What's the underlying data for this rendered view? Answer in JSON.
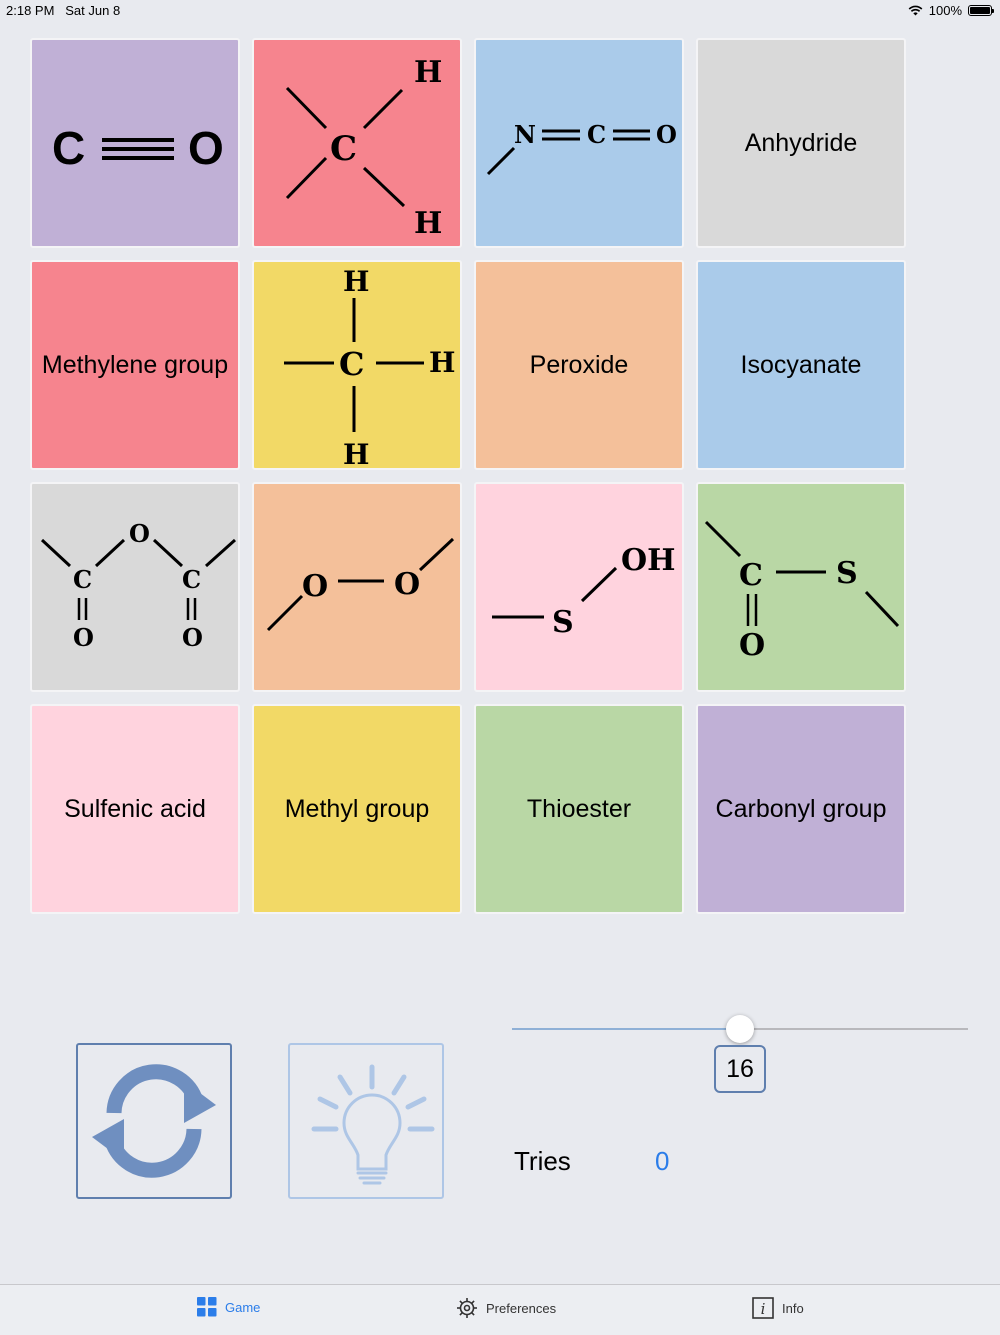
{
  "status_bar": {
    "time": "2:18 PM",
    "date": "Sat Jun 8",
    "battery": "100%"
  },
  "grid": {
    "cards": [
      {
        "kind": "structure",
        "molecule": "carbonyl",
        "color": "#c0b0d6"
      },
      {
        "kind": "structure",
        "molecule": "methylene",
        "color": "#f6848e"
      },
      {
        "kind": "structure",
        "molecule": "isocyanate",
        "color": "#aacbea"
      },
      {
        "kind": "label",
        "text": "Anhydride",
        "color": "#d9d9d9"
      },
      {
        "kind": "label",
        "text": "Methylene group",
        "color": "#f6848e"
      },
      {
        "kind": "structure",
        "molecule": "methyl",
        "color": "#f2d966"
      },
      {
        "kind": "label",
        "text": "Peroxide",
        "color": "#f4c09a"
      },
      {
        "kind": "label",
        "text": "Isocyanate",
        "color": "#aacbea"
      },
      {
        "kind": "structure",
        "molecule": "anhydride",
        "color": "#d9d9d9"
      },
      {
        "kind": "structure",
        "molecule": "peroxide",
        "color": "#f4c09a"
      },
      {
        "kind": "structure",
        "molecule": "sulfenic",
        "color": "#ffd3de"
      },
      {
        "kind": "structure",
        "molecule": "thioester",
        "color": "#b9d7a5"
      },
      {
        "kind": "label",
        "text": "Sulfenic acid",
        "color": "#ffd3de"
      },
      {
        "kind": "label",
        "text": "Methyl group",
        "color": "#f2d966"
      },
      {
        "kind": "label",
        "text": "Thioester",
        "color": "#b9d7a5"
      },
      {
        "kind": "label",
        "text": "Carbonyl group",
        "color": "#c0b0d6"
      }
    ],
    "atoms": {
      "C": "C",
      "O": "O",
      "H": "H",
      "N": "N",
      "S": "S",
      "OH": "OH"
    }
  },
  "controls": {
    "reset_icon": "refresh-icon",
    "hint_icon": "lightbulb-icon",
    "slider_value": "16",
    "slider_fraction": 0.5,
    "tries_label": "Tries",
    "tries_value": "0"
  },
  "tabbar": {
    "tabs": [
      {
        "label": "Game",
        "icon": "grid-icon",
        "active": true
      },
      {
        "label": "Preferences",
        "icon": "gear-icon",
        "active": false
      },
      {
        "label": "Info",
        "icon": "info-icon",
        "active": false
      }
    ]
  },
  "colors": {
    "accent": "#2b7de9",
    "button_border": "#5f7fae",
    "icon_blue": "#6f8fc0"
  }
}
